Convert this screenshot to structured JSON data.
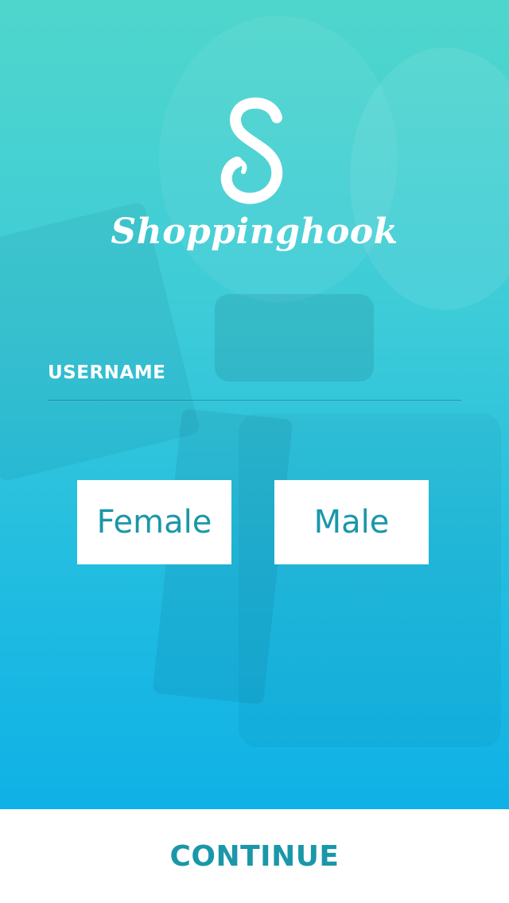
{
  "app": {
    "logo_letter": "S",
    "brand_name": "Shoppinghook"
  },
  "form": {
    "username_label": "USERNAME",
    "username_value": ""
  },
  "gender": {
    "female_label": "Female",
    "male_label": "Male"
  },
  "footer": {
    "continue_label": "CONTINUE"
  },
  "colors": {
    "gradient_top": "#4fd6cc",
    "gradient_bottom": "#0fb1e6",
    "accent_text": "#1a97a8",
    "button_bg": "#ffffff"
  },
  "icons": {
    "logo": "shopping-hook-s-logo"
  }
}
